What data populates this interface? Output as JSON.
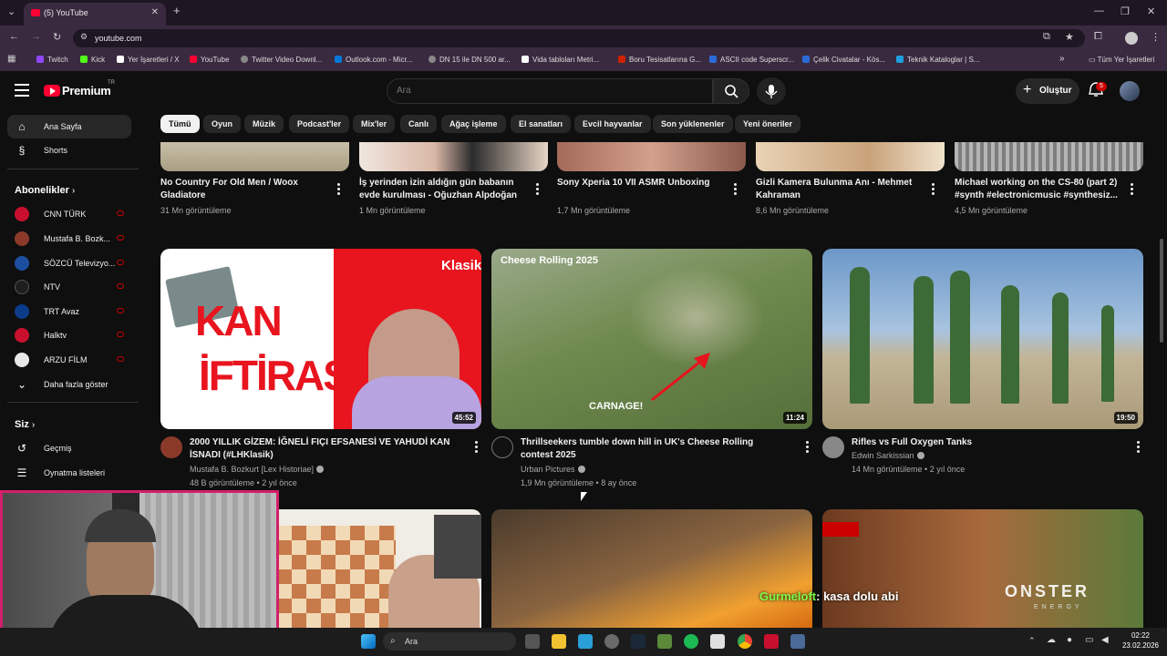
{
  "browser": {
    "tab_title": "(5) YouTube",
    "url": "youtube.com",
    "bookmarks": [
      {
        "label": "Twitch",
        "color": "#9146ff"
      },
      {
        "label": "Kick",
        "color": "#53fc18"
      },
      {
        "label": "Yer İşaretleri / X",
        "color": "#ffffff"
      },
      {
        "label": "YouTube",
        "color": "#ff0033"
      },
      {
        "label": "Twitter Video Downl...",
        "color": "#888888"
      },
      {
        "label": "Outlook.com - Micr...",
        "color": "#0078d4"
      },
      {
        "label": "DN 15 ile DN 500 ar...",
        "color": "#888888"
      },
      {
        "label": "Vida tabloları Metri...",
        "color": "#ffffff"
      },
      {
        "label": "Boru Tesisatlarına G...",
        "color": "#cc2200"
      },
      {
        "label": "ASCII code Superscr...",
        "color": "#2a6bd8"
      },
      {
        "label": "Çelik Civatalar - Kös...",
        "color": "#2a6bd8"
      },
      {
        "label": "Teknik Kataloglar | S...",
        "color": "#1ea0e0"
      }
    ],
    "all_bookmarks": "Tüm Yer İşaretleri"
  },
  "header": {
    "logo_text": "Premium",
    "logo_region": "TR",
    "search_placeholder": "Ara",
    "create_label": "Oluştur",
    "notification_count": "5"
  },
  "sidebar": {
    "main": [
      {
        "label": "Ana Sayfa",
        "icon": "home-icon"
      },
      {
        "label": "Shorts",
        "icon": "shorts-icon"
      }
    ],
    "subscriptions_title": "Abonelikler",
    "subscriptions": [
      {
        "label": "CNN TÜRK",
        "color": "#c8102e"
      },
      {
        "label": "Mustafa B. Bozk...",
        "color": "#8b3a2a"
      },
      {
        "label": "SÖZCÜ Televizyo...",
        "color": "#1d4fa0"
      },
      {
        "label": "NTV",
        "color": "#1e1e1e"
      },
      {
        "label": "TRT Avaz",
        "color": "#0c3b8a"
      },
      {
        "label": "Halktv",
        "color": "#c8102e"
      },
      {
        "label": "ARZU FİLM",
        "color": "#e8e8e8"
      }
    ],
    "show_more": "Daha fazla göster",
    "you_title": "Siz",
    "you_items": [
      {
        "label": "Geçmiş",
        "icon": "history-icon"
      },
      {
        "label": "Oynatma listeleri",
        "icon": "playlist-icon"
      }
    ]
  },
  "chips": [
    "Tümü",
    "Oyun",
    "Müzik",
    "Podcast'ler",
    "Mix'ler",
    "Canlı",
    "Ağaç işleme",
    "El sanatları",
    "Evcil hayvanlar",
    "Son yüklenenler",
    "Yeni öneriler"
  ],
  "top_row": [
    {
      "title": "No Country For Old Men / Woox Gladiatore",
      "meta": "31 Mn görüntüleme",
      "thumb": "#bcb59e"
    },
    {
      "title": "İş yerinden izin aldığın gün babanın evde kurulması - Oğuzhan Alpdoğan",
      "meta": "1 Mn görüntüleme",
      "thumb": "#d9b8a6"
    },
    {
      "title": "Sony Xperia 10 VII ASMR Unboxing",
      "meta": "1,7 Mn görüntüleme",
      "thumb": "#c9907d"
    },
    {
      "title": "Gizli Kamera Bulunma Anı - Mehmet Kahraman",
      "meta": "8,6 Mn görüntüleme",
      "thumb": "#e0c7a4"
    },
    {
      "title": "Michael working on the CS-80 (part 2) #synth #electronicmusic #synthesiz...",
      "meta": "4,5 Mn görüntüleme",
      "thumb": "#9a9a9a"
    }
  ],
  "videos": [
    {
      "title": "2000 YILLIK GİZEM: İĞNELİ FIÇI EFSANESİ VE YAHUDİ KAN İSNADI (#LHKlasik)",
      "channel": "Mustafa B. Bozkurt [Lex Historiae]",
      "meta": "48 B görüntüleme • 2 yıl önce",
      "duration": "45:52",
      "overlay_badge": "Klasik",
      "overlay_line1": "KAN",
      "overlay_line2": "İFTİRASI"
    },
    {
      "title": "Thrillseekers tumble down hill in UK's Cheese Rolling contest 2025",
      "channel": "Urban Pictures",
      "meta": "1,9 Mn görüntüleme • 8 ay önce",
      "duration": "11:24",
      "overlay_title": "Cheese Rolling 2025",
      "overlay_caption": "CARNAGE!"
    },
    {
      "title": "Rifles vs Full Oxygen Tanks",
      "channel": "Edwin Sarkissian",
      "meta": "14 Mn görüntüleme • 2 yıl önce",
      "duration": "19:50"
    }
  ],
  "stream_chat": {
    "user": "Gurmeloft",
    "message": ": kasa dolu abi"
  },
  "row3_overlay": {
    "brand": "ONSTER",
    "sub": "ENERGY"
  },
  "taskbar": {
    "search_label": "Ara",
    "time": "02:22",
    "date": "23.02.2026"
  }
}
